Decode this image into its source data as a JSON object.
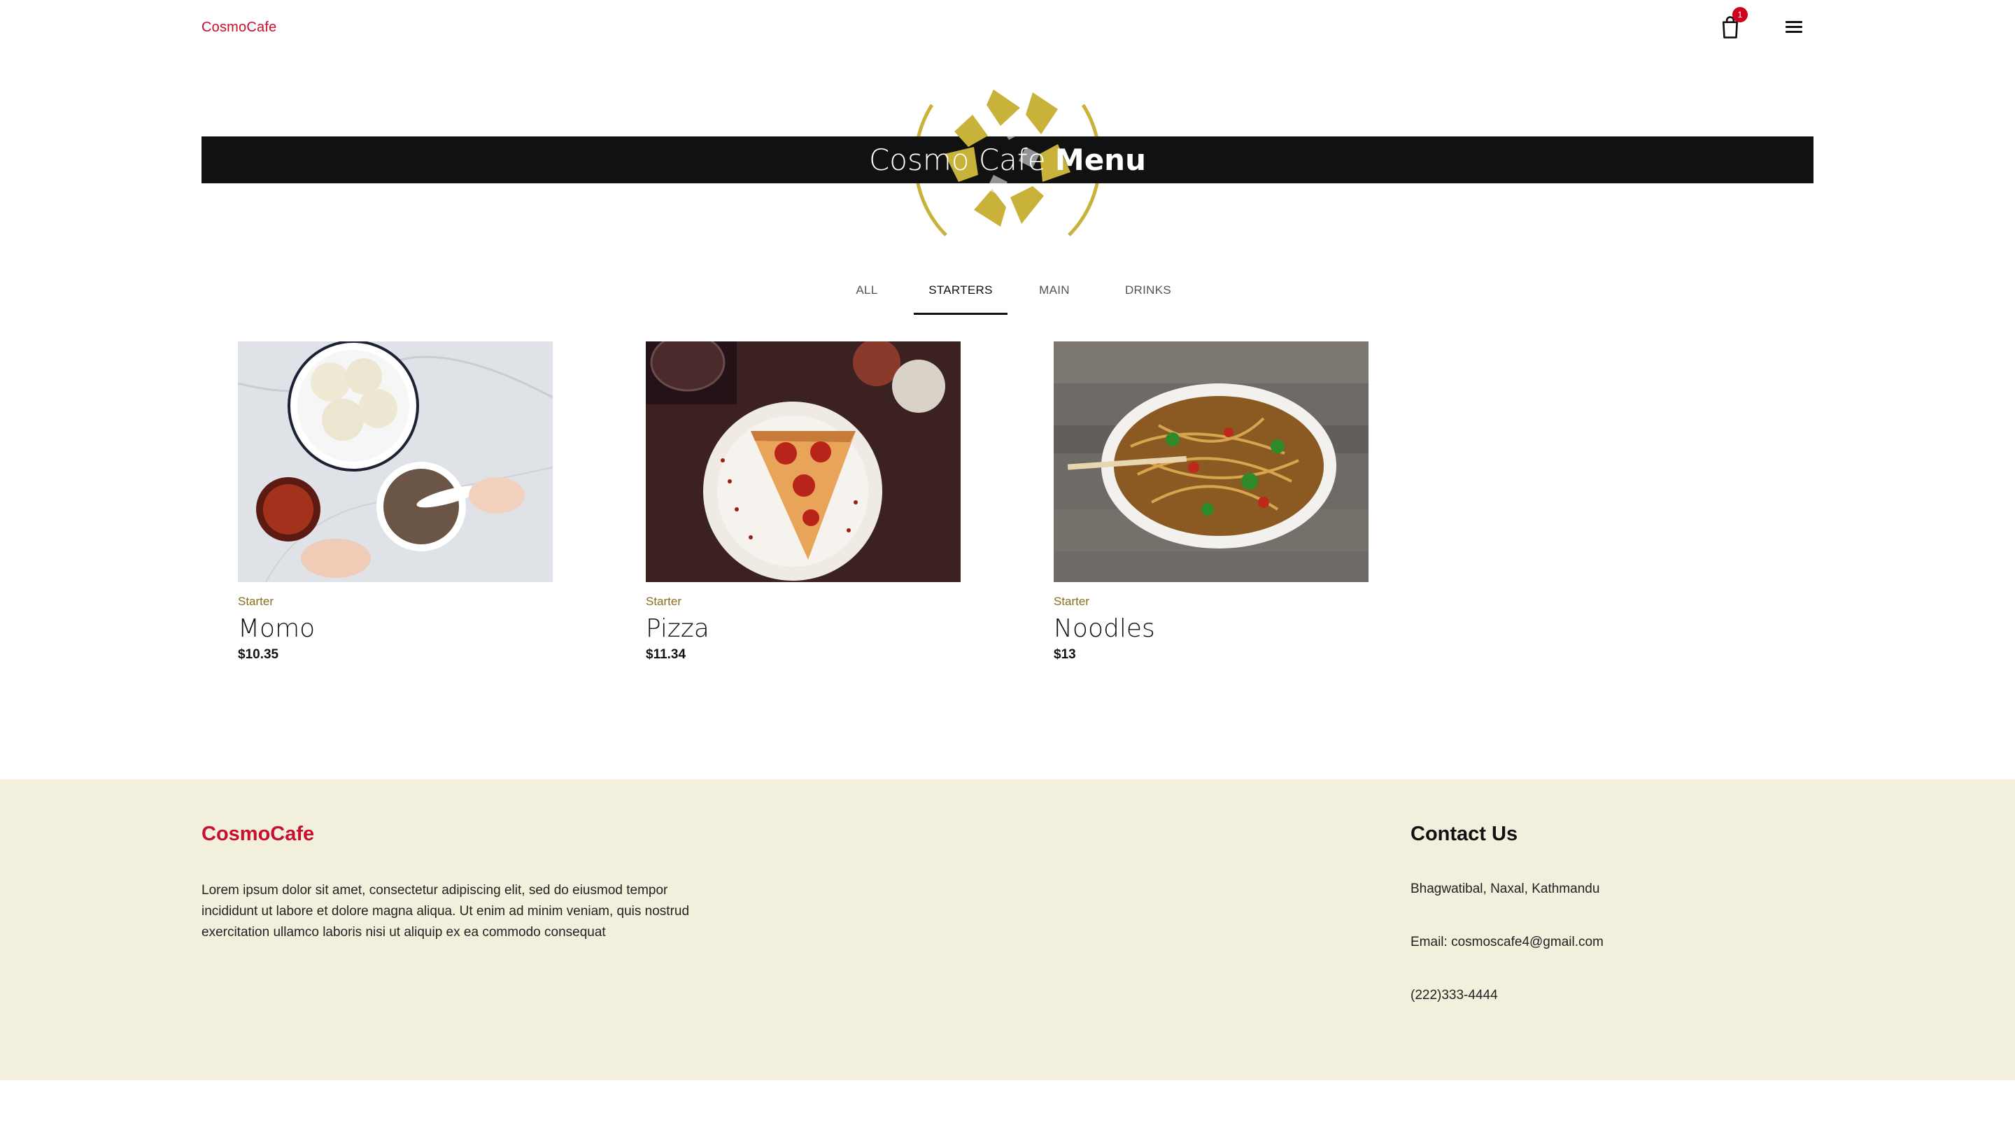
{
  "header": {
    "brand": "CosmoCafe",
    "cart_count": "1",
    "icons": {
      "cart": "shopping-bag-icon",
      "menu": "hamburger-menu-icon"
    }
  },
  "hero": {
    "title_light": "Cosmo Cafe",
    "title_bold": "Menu",
    "logo_color": "#c8b23a"
  },
  "tabs": [
    {
      "label": "ALL",
      "active": false
    },
    {
      "label": "STARTERS",
      "active": true
    },
    {
      "label": "MAIN",
      "active": false
    },
    {
      "label": "DRINKS",
      "active": false
    }
  ],
  "menu": {
    "items": [
      {
        "category": "Starter",
        "name": "Momo",
        "price": "$10.35",
        "image": "momo-photo"
      },
      {
        "category": "Starter",
        "name": "Pizza",
        "price": "$11.34",
        "image": "pizza-photo"
      },
      {
        "category": "Starter",
        "name": "Noodles",
        "price": "$13",
        "image": "noodles-photo"
      }
    ]
  },
  "footer": {
    "brand": "CosmoCafe",
    "about": "Lorem ipsum dolor sit amet, consectetur adipiscing elit, sed do eiusmod tempor incididunt ut labore et dolore magna aliqua. Ut enim ad minim veniam, quis nostrud exercitation ullamco laboris nisi ut aliquip ex ea commodo consequat",
    "contact_title": "Contact Us",
    "address": "Bhagwatibal, Naxal, Kathmandu",
    "email": "Email: cosmoscafe4@gmail.com",
    "phone": "(222)333-4444"
  },
  "colors": {
    "brand_red": "#c8102e",
    "footer_bg": "#f2efdc",
    "banner_bg": "#111111",
    "accent_gold": "#c8b23a"
  }
}
